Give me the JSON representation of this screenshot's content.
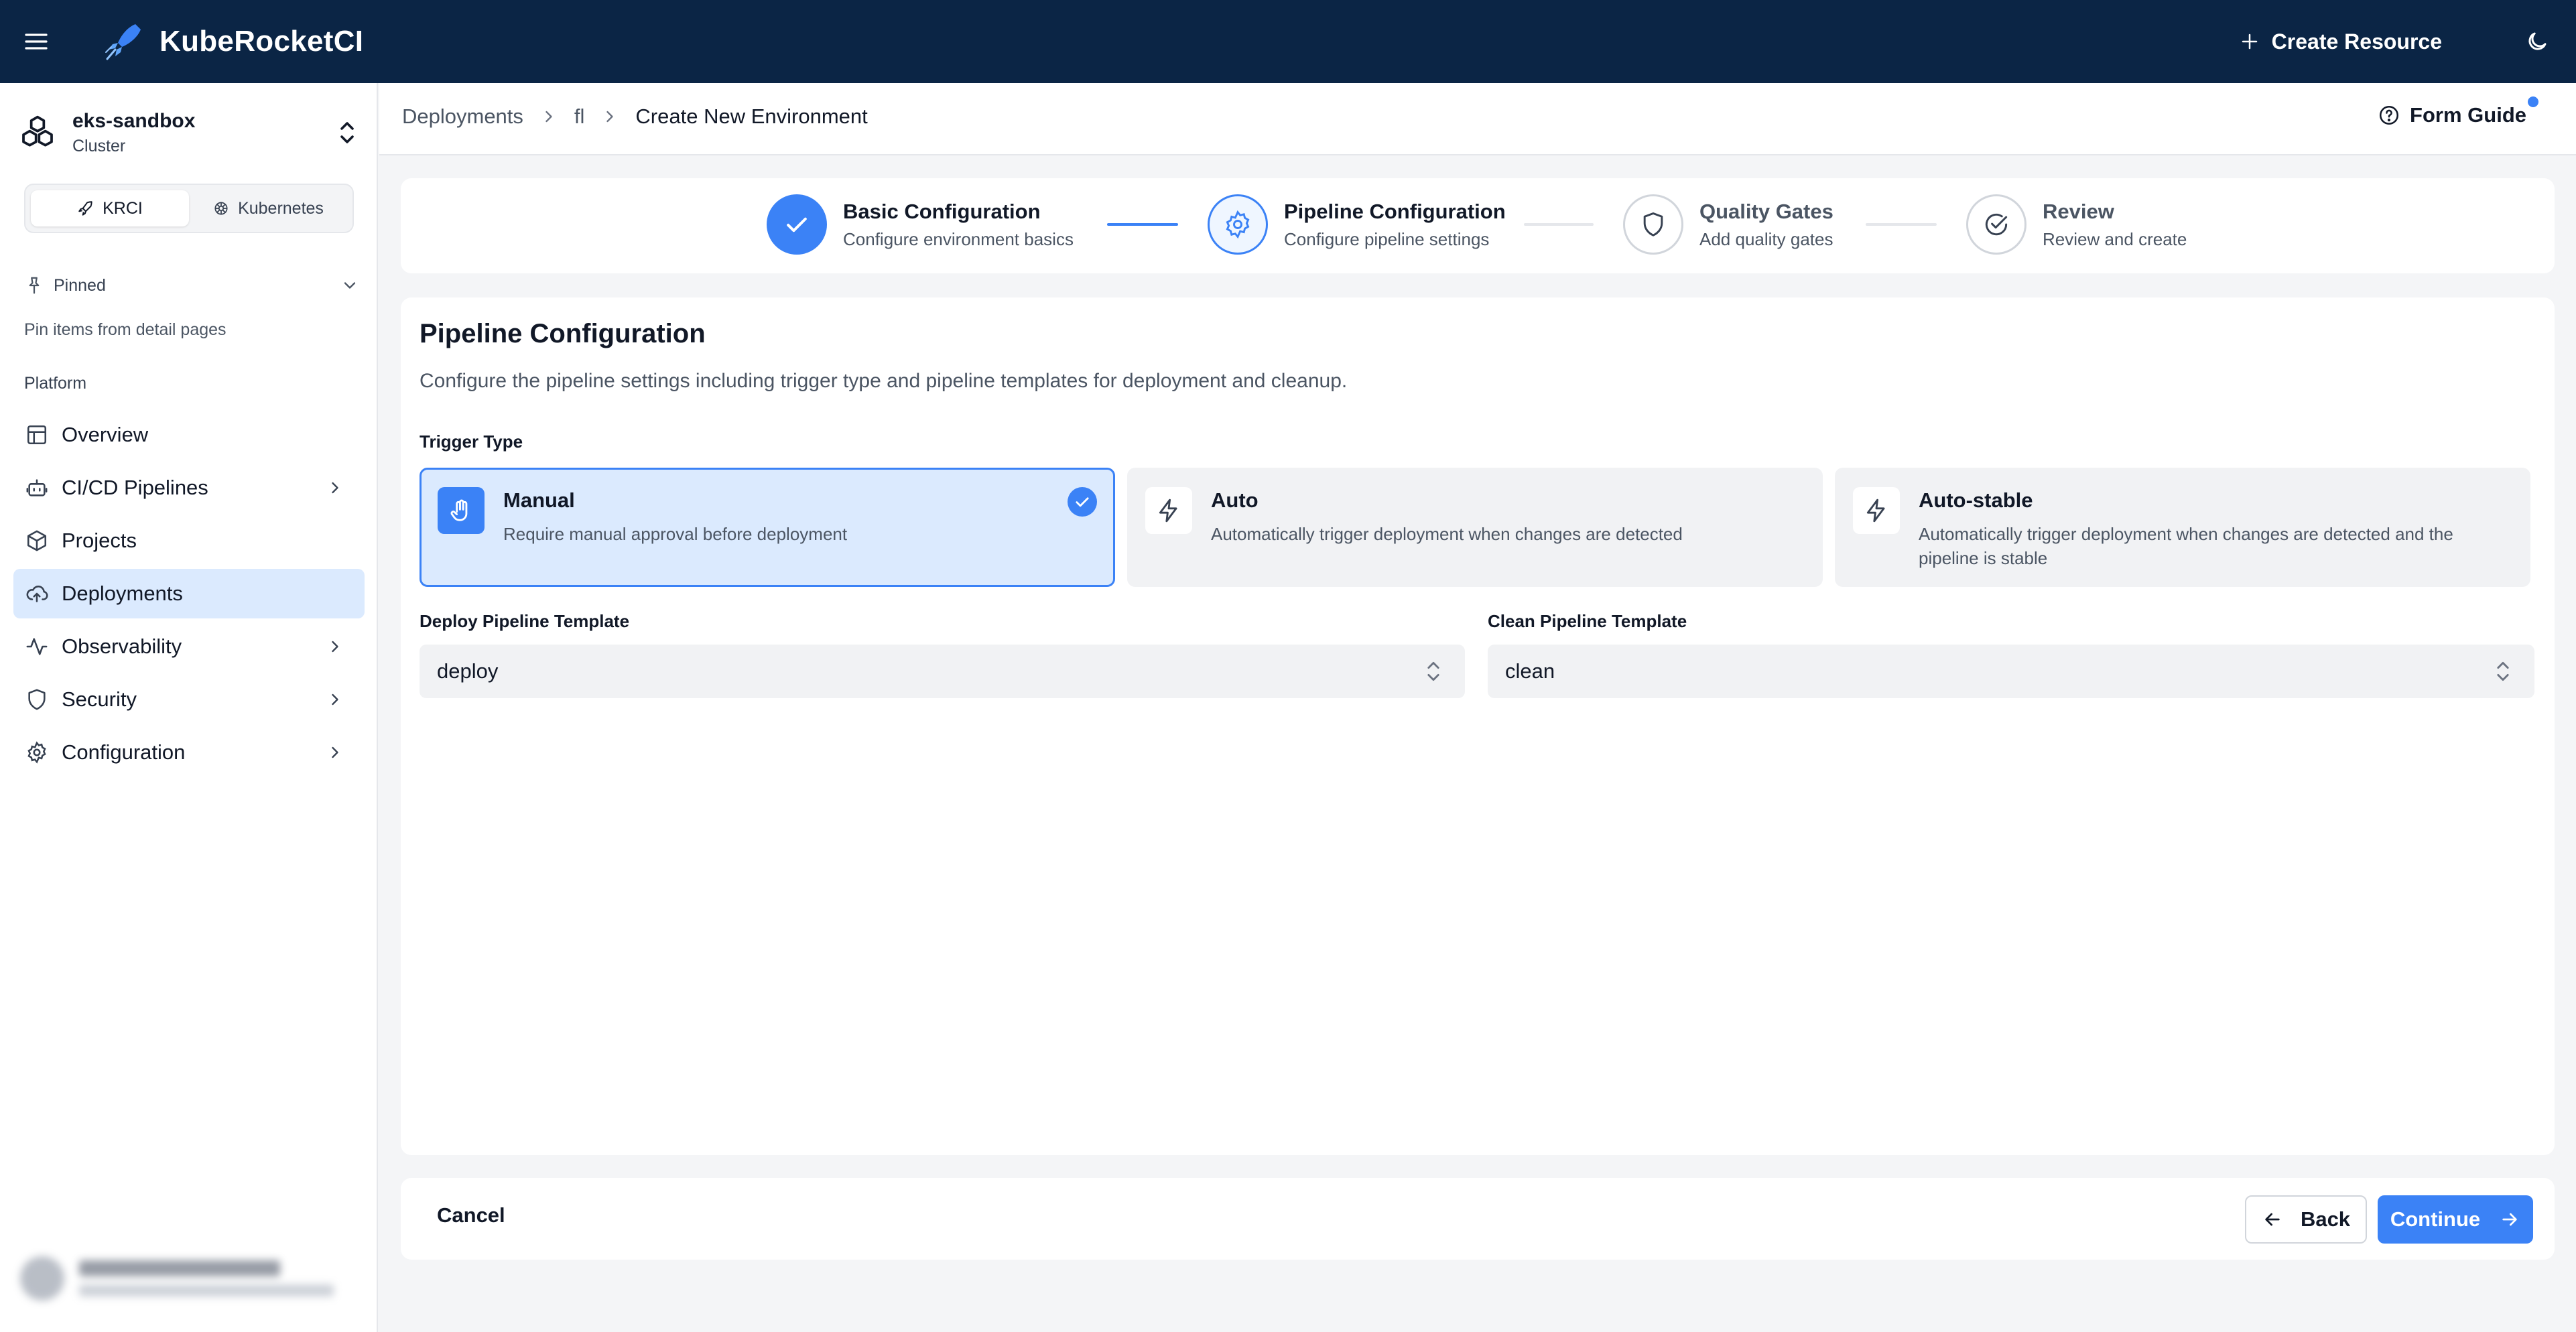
{
  "app": {
    "title": "KubeRocketCI"
  },
  "topbar": {
    "menu_icon": "hamburger-menu-icon",
    "create_resource_label": "Create Resource",
    "theme_icon": "moon-icon"
  },
  "sidebar": {
    "cluster": {
      "name": "eks-sandbox",
      "subtitle": "Cluster"
    },
    "segments": [
      {
        "label": "KRCI",
        "icon": "rocket-icon",
        "active": true
      },
      {
        "label": "Kubernetes",
        "icon": "helm-icon",
        "active": false
      }
    ],
    "pinned": {
      "label": "Pinned",
      "hint": "Pin items from detail pages"
    },
    "section_label": "Platform",
    "items": [
      {
        "label": "Overview",
        "icon": "layout-icon",
        "has_children": false
      },
      {
        "label": "CI/CD Pipelines",
        "icon": "robot-icon",
        "has_children": true
      },
      {
        "label": "Projects",
        "icon": "box-icon",
        "has_children": false
      },
      {
        "label": "Deployments",
        "icon": "cloud-upload-icon",
        "has_children": false,
        "active": true
      },
      {
        "label": "Observability",
        "icon": "activity-icon",
        "has_children": true
      },
      {
        "label": "Security",
        "icon": "shield-icon",
        "has_children": true
      },
      {
        "label": "Configuration",
        "icon": "gear-icon",
        "has_children": true
      }
    ]
  },
  "header": {
    "breadcrumb": [
      "Deployments",
      "fl",
      "Create New Environment"
    ],
    "form_guide_label": "Form Guide"
  },
  "stepper": {
    "steps": [
      {
        "title": "Basic Configuration",
        "desc": "Configure environment basics",
        "state": "done"
      },
      {
        "title": "Pipeline Configuration",
        "desc": "Configure pipeline settings",
        "state": "current"
      },
      {
        "title": "Quality Gates",
        "desc": "Add quality gates",
        "state": "pending"
      },
      {
        "title": "Review",
        "desc": "Review and create",
        "state": "pending"
      }
    ]
  },
  "form": {
    "title": "Pipeline Configuration",
    "description": "Configure the pipeline settings including trigger type and pipeline templates for deployment and cleanup.",
    "trigger_label": "Trigger Type",
    "trigger_options": [
      {
        "title": "Manual",
        "desc": "Require manual approval before deployment",
        "icon": "hand-icon",
        "selected": true
      },
      {
        "title": "Auto",
        "desc": "Automatically trigger deployment when changes are detected",
        "icon": "lightning-icon",
        "selected": false
      },
      {
        "title": "Auto-stable",
        "desc": "Automatically trigger deployment when changes are detected and the pipeline is stable",
        "icon": "lightning-icon",
        "selected": false
      }
    ],
    "deploy_template": {
      "label": "Deploy Pipeline Template",
      "value": "deploy"
    },
    "clean_template": {
      "label": "Clean Pipeline Template",
      "value": "clean"
    }
  },
  "footer": {
    "cancel_label": "Cancel",
    "back_label": "Back",
    "continue_label": "Continue"
  },
  "colors": {
    "topbar": "#0b2545",
    "accent": "#3b82f6",
    "selected_bg": "#dbeafe"
  }
}
